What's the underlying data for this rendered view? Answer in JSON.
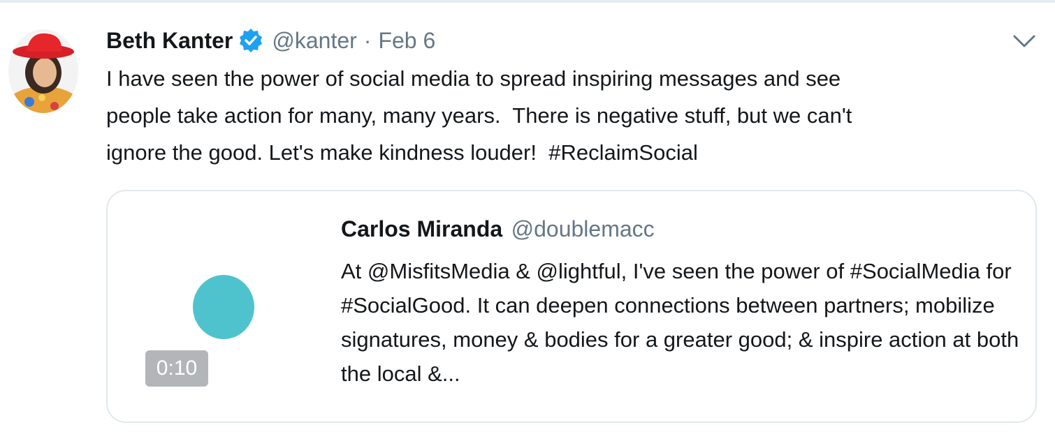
{
  "tweet": {
    "author_name": "Beth Kanter",
    "author_handle": "@kanter",
    "separator": "·",
    "date": "Feb 6",
    "text": "I have seen the power of social media to spread inspiring messages and see\npeople take action for many, many years.  There is negative stuff, but we can't\nignore the good. Let's make kindness louder!  #ReclaimSocial",
    "avatar_icon": "avatar-red-hat",
    "verified_icon": "verified-badge-icon",
    "menu_icon": "chevron-down-icon"
  },
  "quoted_tweet": {
    "author_name": "Carlos Miranda",
    "author_handle": "@doublemacc",
    "text": "At @MisfitsMedia & @lightful, I've seen the power of #SocialMedia for #SocialGood. It can deepen connections between partners; mobilize signatures, money & bodies for a greater good; & inspire action at both the local &...",
    "video_duration": "0:10"
  },
  "colors": {
    "accent": "#1da1f2",
    "secondary_text": "#657786",
    "video_dot": "#4fc3cd",
    "border": "#e1e8ed"
  }
}
